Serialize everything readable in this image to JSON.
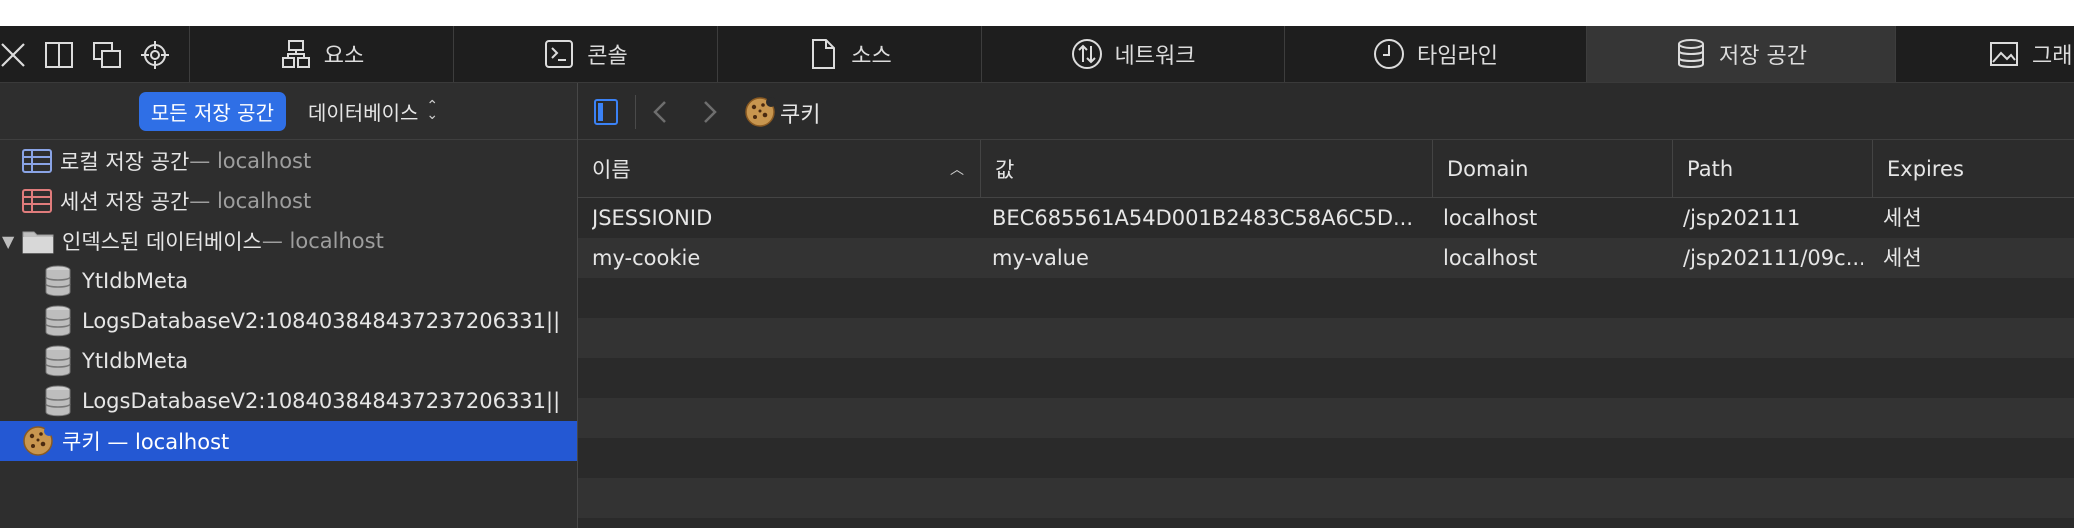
{
  "tabs": [
    {
      "label": "요소",
      "icon": "elements-icon"
    },
    {
      "label": "콘솔",
      "icon": "console-icon"
    },
    {
      "label": "소스",
      "icon": "sources-icon"
    },
    {
      "label": "네트워크",
      "icon": "network-icon"
    },
    {
      "label": "타임라인",
      "icon": "timeline-icon"
    },
    {
      "label": "저장 공간",
      "icon": "storage-icon"
    },
    {
      "label": "그래픽",
      "icon": "graphics-icon"
    }
  ],
  "sidebar": {
    "scope_all": "모든 저장 공간",
    "scope_select": "데이터베이스",
    "items": [
      {
        "label": "로컬 저장 공간",
        "sub": " — localhost"
      },
      {
        "label": "세션 저장 공간",
        "sub": " — localhost"
      },
      {
        "label": "인덱스된 데이터베이스",
        "sub": " — localhost"
      },
      {
        "label": "YtIdbMeta",
        "sub": ""
      },
      {
        "label": "LogsDatabaseV2:10840384843723720633​1||",
        "sub": ""
      },
      {
        "label": "YtIdbMeta",
        "sub": ""
      },
      {
        "label": "LogsDatabaseV2:10840384843723720633​1||",
        "sub": ""
      },
      {
        "label": "쿠키 — localhost",
        "sub": ""
      }
    ]
  },
  "nav": {
    "title": "쿠키"
  },
  "table": {
    "columns": [
      "이름",
      "값",
      "Domain",
      "Path",
      "Expires"
    ],
    "rows": [
      [
        "JSESSIONID",
        "BEC685561A54D001B2483C58A6C5D...",
        "localhost",
        "/jsp202111",
        "세션"
      ],
      [
        "my-cookie",
        "my-value",
        "localhost",
        "/jsp202111/09c...",
        "세션"
      ]
    ]
  }
}
